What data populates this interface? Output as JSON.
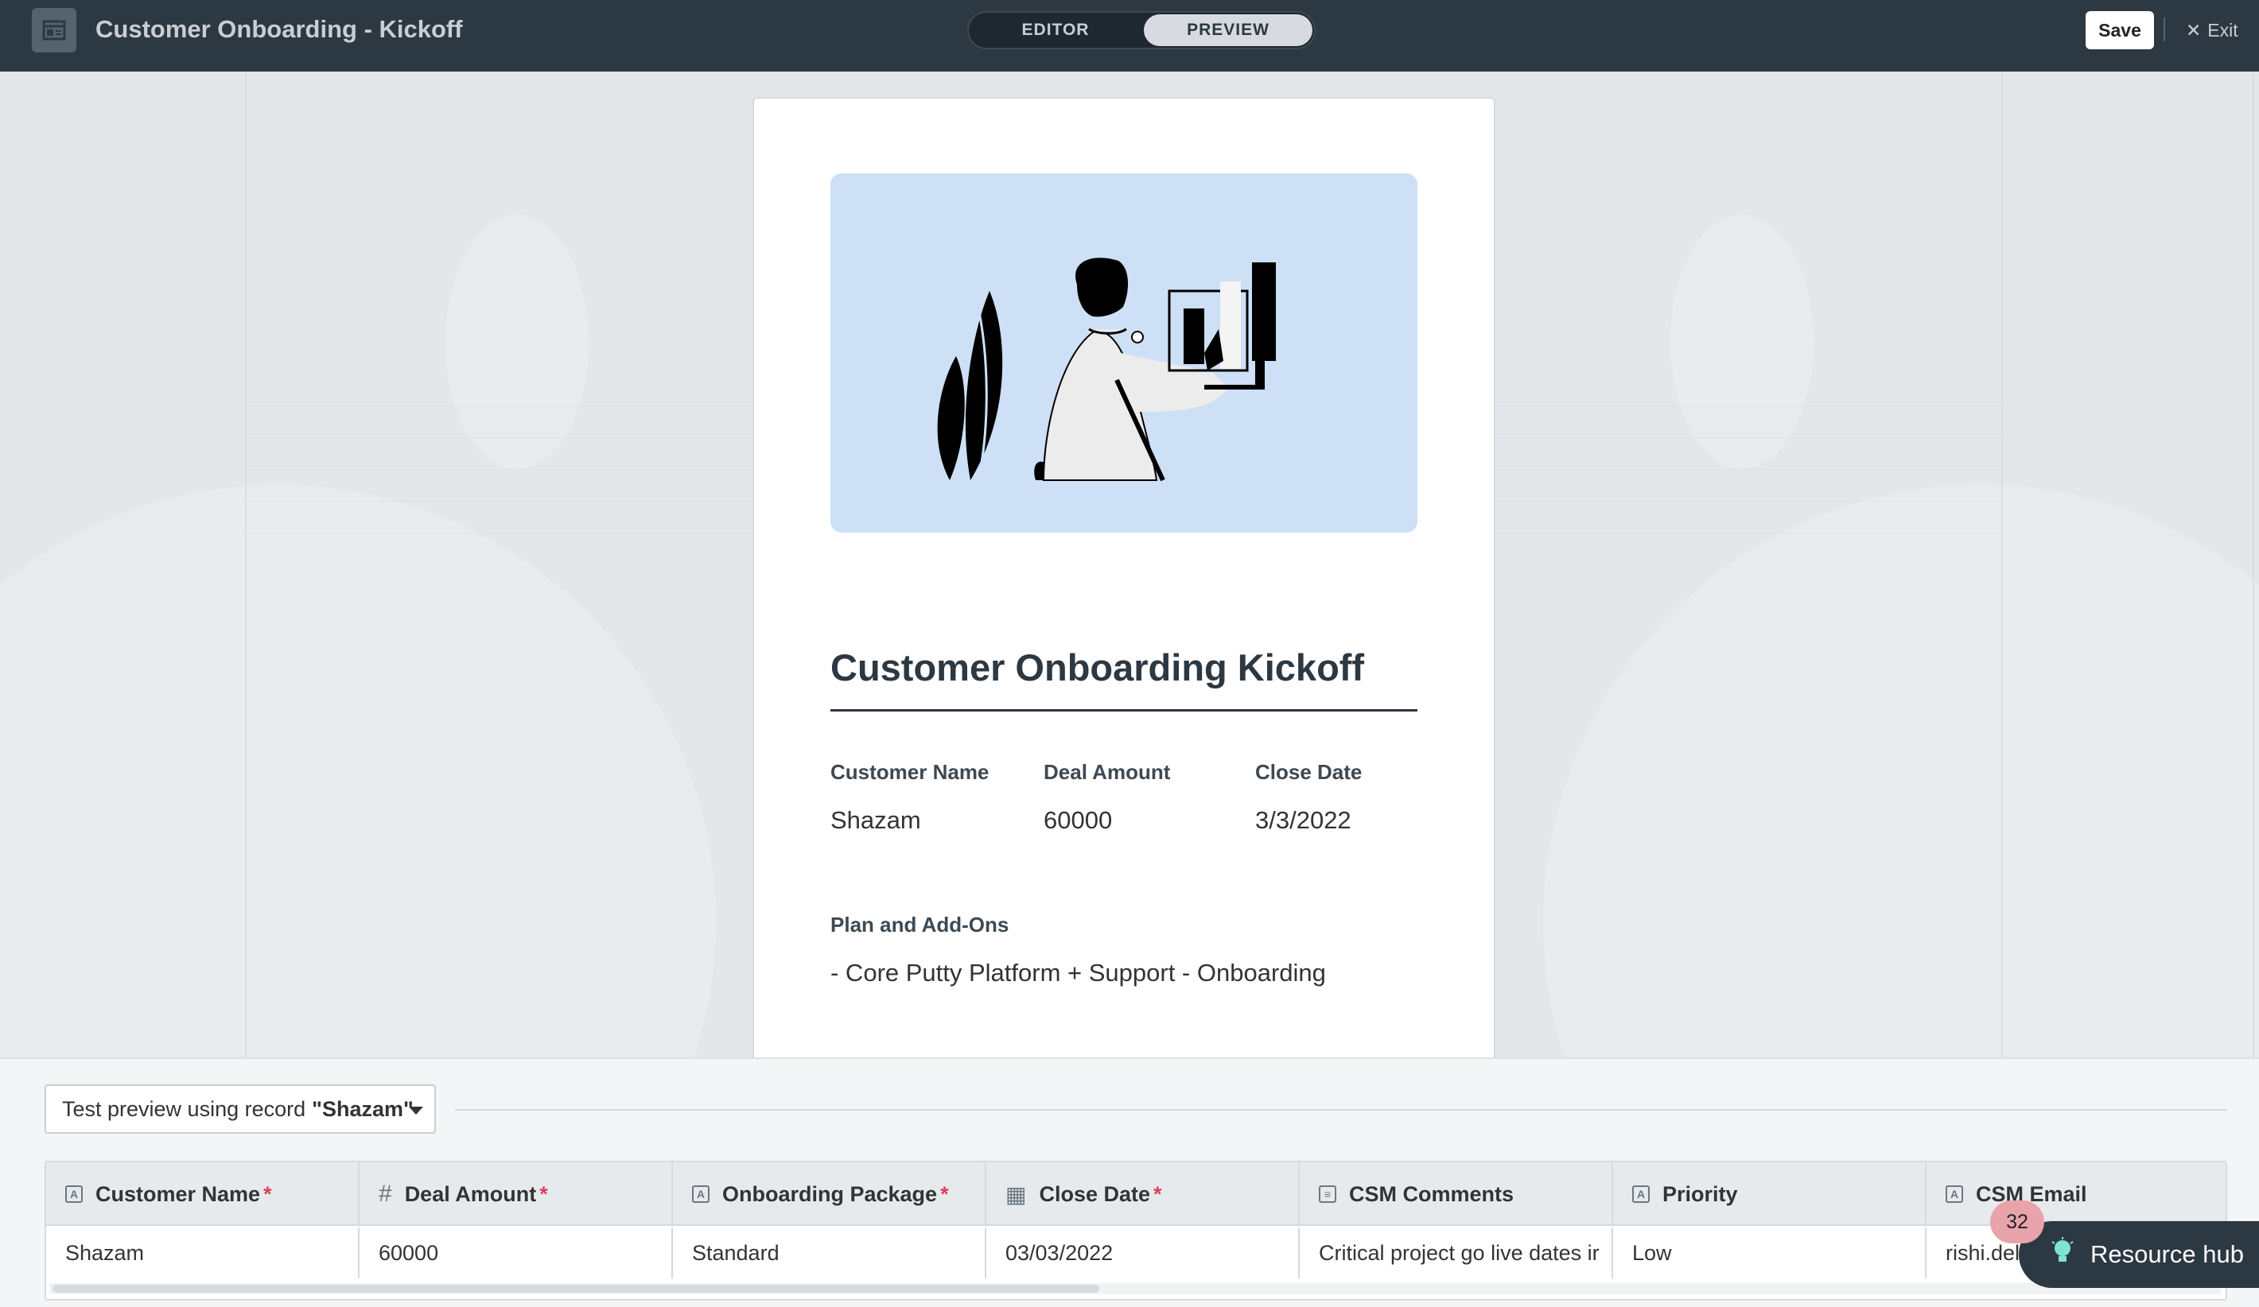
{
  "header": {
    "title": "Customer Onboarding - Kickoff",
    "mode_editor": "EDITOR",
    "mode_preview": "PREVIEW",
    "save_label": "Save",
    "exit_label": "Exit"
  },
  "document": {
    "title": "Customer Onboarding Kickoff",
    "fields": [
      {
        "label": "Customer Name",
        "value": "Shazam"
      },
      {
        "label": "Deal Amount",
        "value": "60000"
      },
      {
        "label": "Close Date",
        "value": "3/3/2022"
      }
    ],
    "plan": {
      "label": "Plan and Add-Ons",
      "value": "- Core Putty Platform + Support - Onboarding"
    }
  },
  "preview_bar": {
    "select_prefix": "Test preview using record",
    "select_record": "\"Shazam\""
  },
  "table": {
    "columns": [
      {
        "label": "Customer Name",
        "icon": "text-field-icon",
        "glyph": "A",
        "required": "*"
      },
      {
        "label": "Deal Amount",
        "icon": "number-field-icon",
        "glyph": "#",
        "required": "*"
      },
      {
        "label": "Onboarding Package",
        "icon": "text-field-icon",
        "glyph": "A",
        "required": "*"
      },
      {
        "label": "Close Date",
        "icon": "calendar-icon",
        "glyph": "▦",
        "required": "*"
      },
      {
        "label": "CSM Comments",
        "icon": "long-text-icon",
        "glyph": "≡",
        "required": ""
      },
      {
        "label": "Priority",
        "icon": "text-field-icon",
        "glyph": "A",
        "required": ""
      },
      {
        "label": "CSM Email",
        "icon": "text-field-icon",
        "glyph": "A",
        "required": ""
      }
    ],
    "row": [
      "Shazam",
      "60000",
      "Standard",
      "03/03/2022",
      "Critical project go live dates ir",
      "Low",
      "rishi.del"
    ]
  },
  "resource_hub": {
    "label": "Resource hub",
    "badge": "32"
  }
}
